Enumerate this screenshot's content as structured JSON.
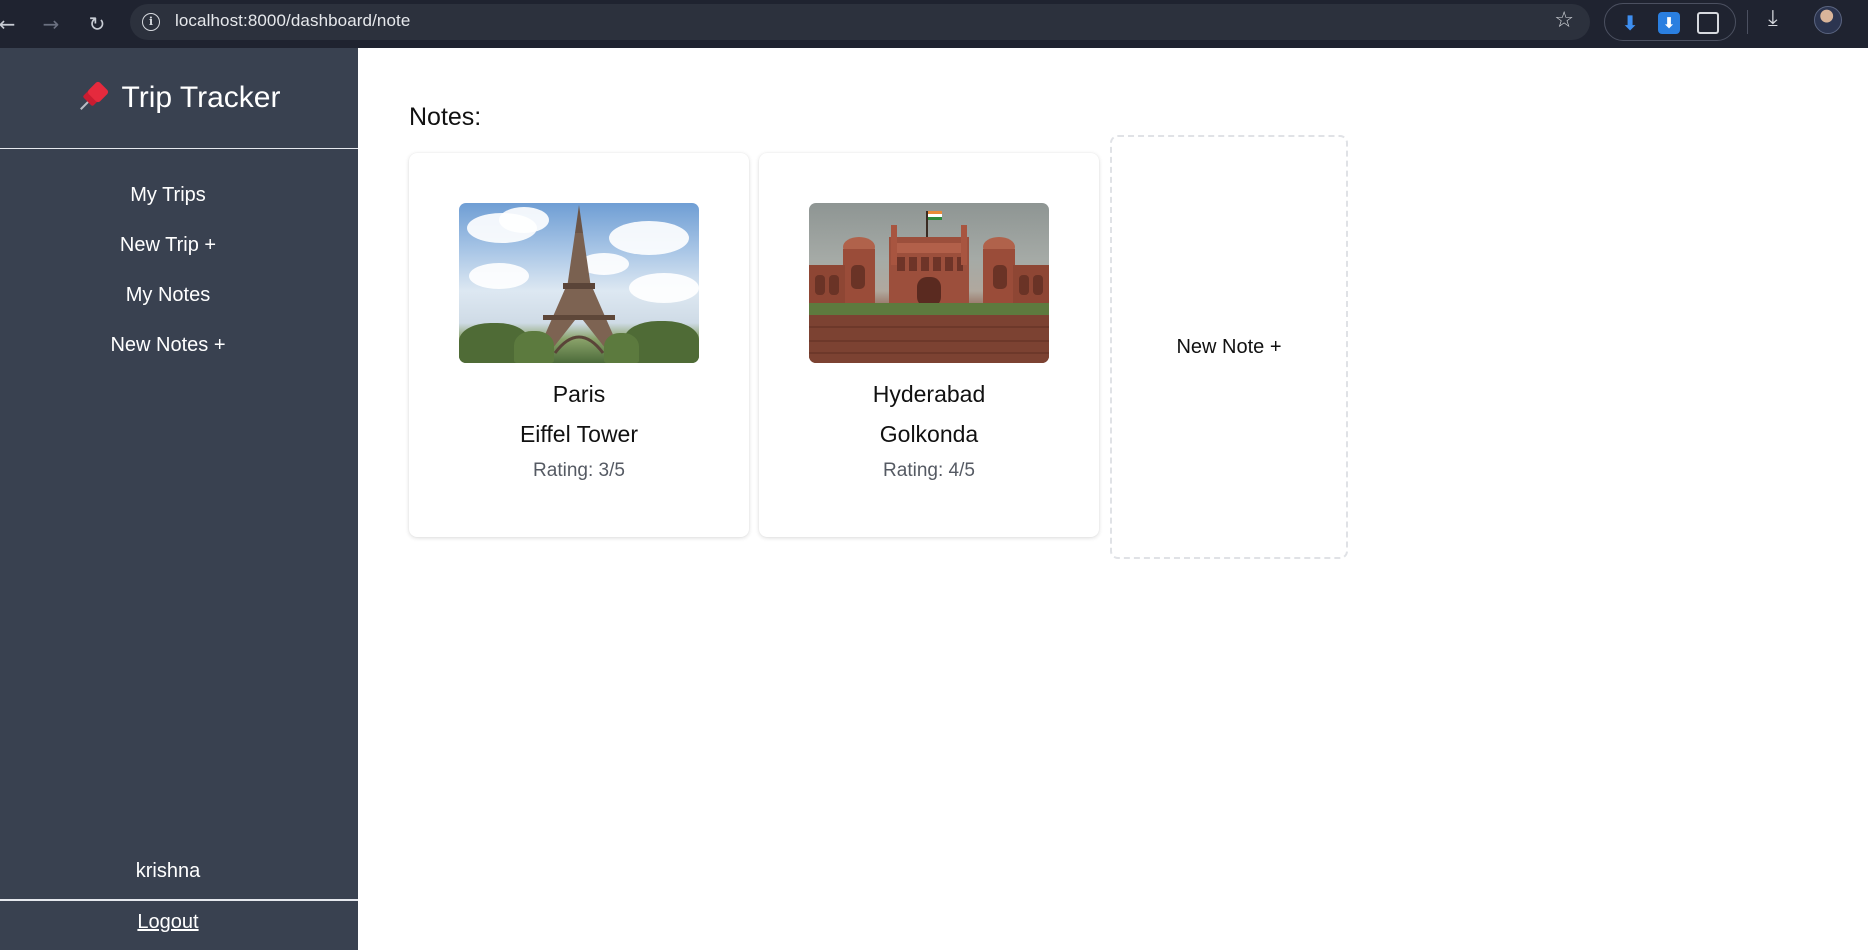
{
  "browser": {
    "url": "localhost:8000/dashboard/note",
    "icons": [
      "back-icon",
      "forward-icon",
      "reload-icon",
      "info-icon",
      "star-icon",
      "download-extension-icon",
      "download-extension-icon",
      "extensions-icon",
      "downloads-icon",
      "profile-avatar"
    ]
  },
  "sidebar": {
    "brand_title": "Trip Tracker",
    "brand_icon": "pushpin-icon",
    "items": [
      {
        "label": "My Trips"
      },
      {
        "label": "New Trip +"
      },
      {
        "label": "My Notes"
      },
      {
        "label": "New Notes +"
      }
    ],
    "user_name": "krishna",
    "logout_label": "Logout"
  },
  "main": {
    "section_title": "Notes:",
    "notes": [
      {
        "city": "Paris",
        "place": "Eiffel Tower",
        "rating": "Rating: 3/5",
        "rating_value": 3,
        "rating_max": 5,
        "image": "eiffel-tower-photo"
      },
      {
        "city": "Hyderabad",
        "place": "Golkonda",
        "rating": "Rating: 4/5",
        "rating_value": 4,
        "rating_max": 5,
        "image": "red-fort-photo"
      }
    ],
    "new_note_label": "New Note +"
  },
  "colors": {
    "sidebar_bg": "#394150",
    "browser_bg": "#1f2330",
    "accent_pin": "#e52a3d"
  }
}
